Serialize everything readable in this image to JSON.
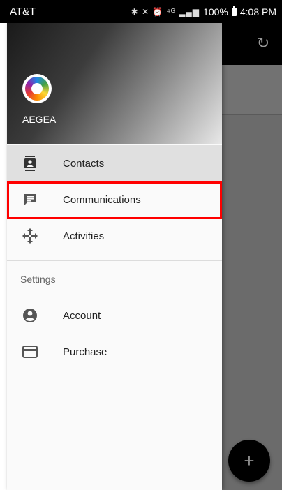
{
  "status_bar": {
    "carrier": "AT&T",
    "icons": "✱ ✕ ⏰ ⁴ᴳ ▂▄▆",
    "battery": "100%",
    "time": "4:08 PM"
  },
  "drawer": {
    "header": {
      "app_name": "AEGEA",
      "logo": "aegea-logo"
    },
    "items": [
      {
        "label": "Contacts",
        "icon": "contacts-icon",
        "active": true
      },
      {
        "label": "Communications",
        "icon": "chat-icon",
        "highlighted": true
      },
      {
        "label": "Activities",
        "icon": "move-icon"
      }
    ],
    "settings": {
      "title": "Settings",
      "items": [
        {
          "label": "Account",
          "icon": "account-circle-icon"
        },
        {
          "label": "Purchase",
          "icon": "credit-card-icon"
        }
      ]
    }
  },
  "background": {
    "toolbar_icon": "refresh-icon",
    "fab_label": "+"
  },
  "colors": {
    "highlight": "#ff0000",
    "active_item": "#e0e0e0",
    "scrim": "#6b6b6b"
  }
}
